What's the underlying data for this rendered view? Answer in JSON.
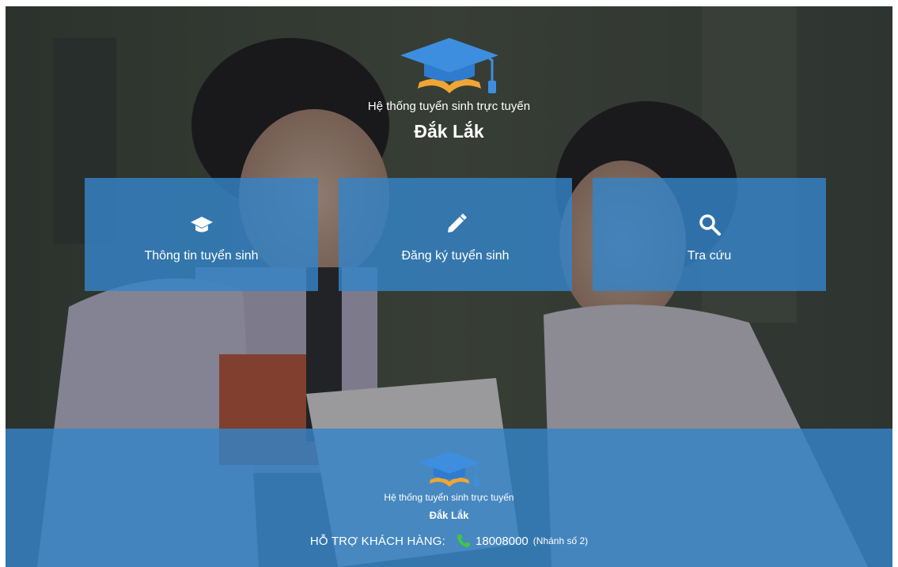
{
  "brand": {
    "subtitle": "Hệ thống tuyển sinh trực tuyến",
    "title": "Đắk Lắk"
  },
  "tiles": [
    {
      "label": "Thông tin tuyển sinh",
      "icon": "graduation-cap-icon"
    },
    {
      "label": "Đăng ký tuyển sinh",
      "icon": "pencil-icon"
    },
    {
      "label": "Tra cứu",
      "icon": "search-icon"
    }
  ],
  "footer": {
    "subtitle": "Hệ thống tuyển sinh trực tuyến",
    "title": "Đắk Lắk",
    "support_label": "HỖ TRỢ KHÁCH HÀNG:",
    "phone_number": "18008000",
    "phone_branch": "(Nhánh số 2)"
  },
  "colors": {
    "accent": "#3584c8",
    "cap_blue": "#3e8ee0",
    "book_orange": "#f0a634",
    "phone_green": "#3ec93e"
  }
}
